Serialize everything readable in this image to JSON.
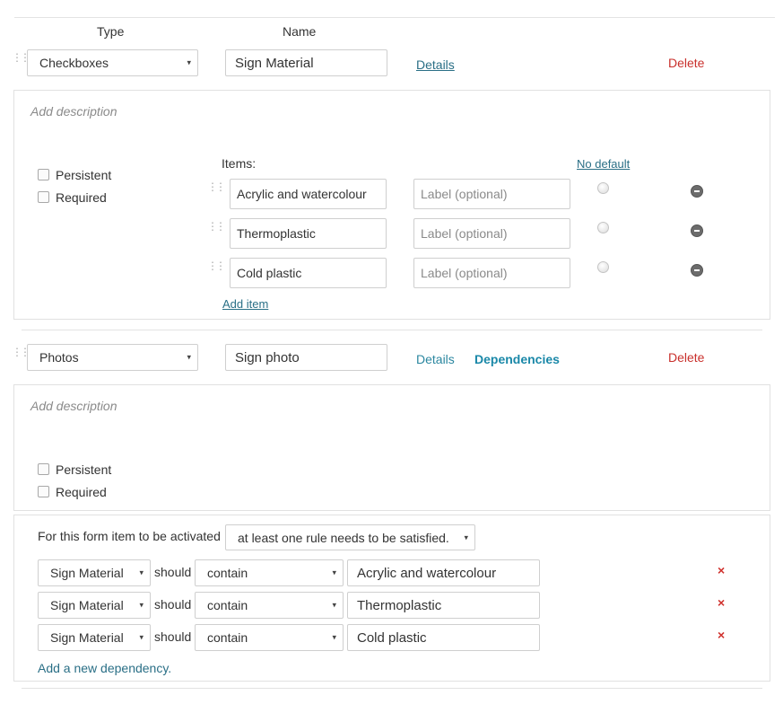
{
  "header": {
    "type_label": "Type",
    "name_label": "Name"
  },
  "field1": {
    "type_value": "Checkboxes",
    "name_value": "Sign Material",
    "details_label": "Details",
    "delete_label": "Delete",
    "description_placeholder": "Add description",
    "persistent_label": "Persistent",
    "required_label": "Required",
    "items_label": "Items:",
    "no_default_label": "No default",
    "items": [
      {
        "value": "Acrylic and watercolour",
        "label_placeholder": "Label (optional)"
      },
      {
        "value": "Thermoplastic",
        "label_placeholder": "Label (optional)"
      },
      {
        "value": "Cold plastic",
        "label_placeholder": "Label (optional)"
      }
    ],
    "add_item_label": "Add item"
  },
  "field2": {
    "type_value": "Photos",
    "name_value": "Sign photo",
    "details_label": "Details",
    "dependencies_label": "Dependencies",
    "delete_label": "Delete",
    "description_placeholder": "Add description",
    "persistent_label": "Persistent",
    "required_label": "Required"
  },
  "dependencies": {
    "intro_label": "For this form item to be activated",
    "rule_mode": "at least one rule needs to be satisfied.",
    "rules": [
      {
        "field": "Sign Material",
        "should": "should",
        "op": "contain",
        "value": "Acrylic and watercolour",
        "remove": "×"
      },
      {
        "field": "Sign Material",
        "should": "should",
        "op": "contain",
        "value": "Thermoplastic",
        "remove": "×"
      },
      {
        "field": "Sign Material",
        "should": "should",
        "op": "contain",
        "value": "Cold plastic",
        "remove": "×"
      }
    ],
    "add_label": "Add a new dependency."
  },
  "icons": {
    "dropdown": "▾",
    "grip": "drag-handle-icon",
    "remove_item": "minus-circle-icon",
    "remove_rule": "close-icon"
  },
  "colors": {
    "link": "#2b87a0",
    "delete": "#c9302c",
    "remove": "#d0312d"
  }
}
